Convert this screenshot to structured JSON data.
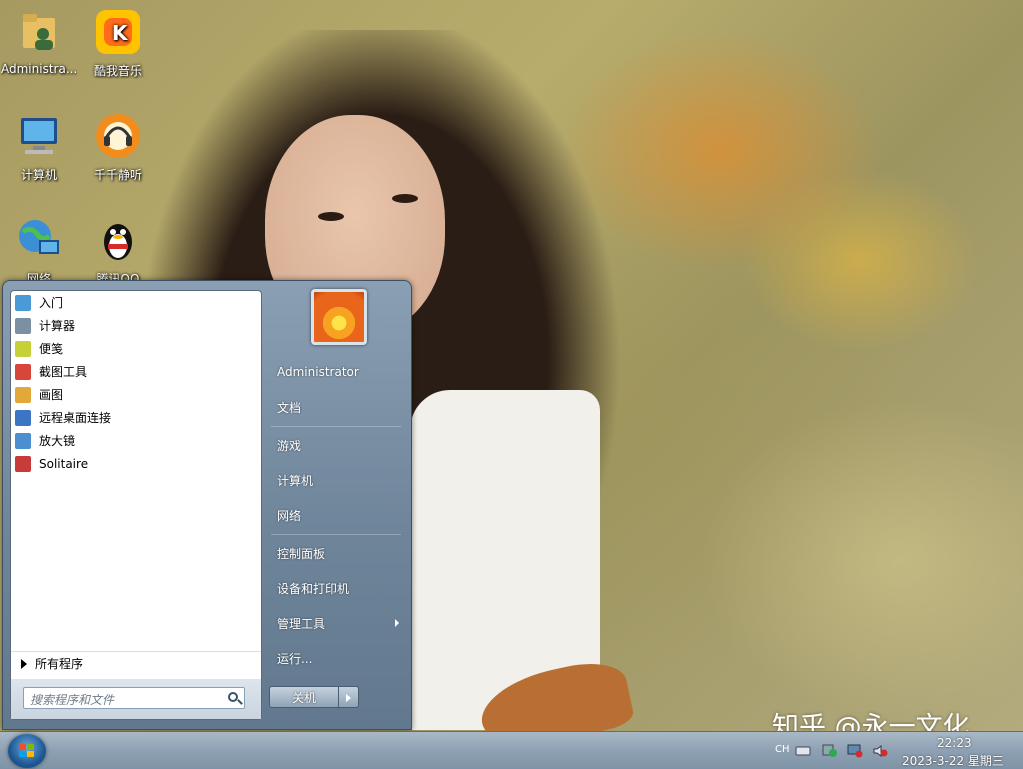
{
  "desktop": {
    "icons": [
      {
        "label": "Administra...",
        "icon": "user-folder-icon"
      },
      {
        "label": "酷我音乐",
        "icon": "kuwo-music-icon"
      },
      {
        "label": "计算机",
        "icon": "computer-icon"
      },
      {
        "label": "千千静听",
        "icon": "ttplayer-icon"
      },
      {
        "label": "网络",
        "icon": "network-icon"
      },
      {
        "label": "腾讯QQ",
        "icon": "qq-penguin-icon"
      }
    ]
  },
  "start_menu": {
    "programs": [
      {
        "label": "入门",
        "icon": "getting-started-icon",
        "color": "#4a9ad8"
      },
      {
        "label": "计算器",
        "icon": "calculator-icon",
        "color": "#7d8fa3"
      },
      {
        "label": "便笺",
        "icon": "sticky-notes-icon",
        "color": "#c6d13a"
      },
      {
        "label": "截图工具",
        "icon": "snipping-tool-icon",
        "color": "#d8453a"
      },
      {
        "label": "画图",
        "icon": "paint-icon",
        "color": "#e2a93a"
      },
      {
        "label": "远程桌面连接",
        "icon": "remote-desktop-icon",
        "color": "#3b75c4"
      },
      {
        "label": "放大镜",
        "icon": "magnifier-icon",
        "color": "#4b8fd0"
      },
      {
        "label": "Solitaire",
        "icon": "solitaire-icon",
        "color": "#c83b3b"
      }
    ],
    "all_programs": "所有程序",
    "search_placeholder": "搜索程序和文件",
    "right_items": [
      {
        "label": "Administrator"
      },
      {
        "label": "文档"
      },
      {
        "label": "游戏"
      },
      {
        "label": "计算机"
      },
      {
        "label": "网络"
      },
      {
        "label": "控制面板"
      },
      {
        "label": "设备和打印机"
      },
      {
        "label": "管理工具",
        "submenu": true
      },
      {
        "label": "运行..."
      }
    ],
    "shutdown_label": "关机"
  },
  "taskbar": {
    "tray_lang": "CH",
    "time": "22:23",
    "date": "2023-3-22 星期三"
  },
  "watermark": "知乎 @永一文化"
}
